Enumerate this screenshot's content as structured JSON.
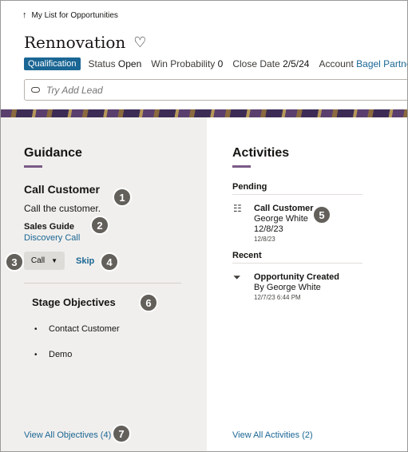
{
  "header": {
    "breadcrumb": "My List for Opportunities",
    "title": "Rennovation",
    "stage_badge": "Qualification",
    "status_label": "Status",
    "status_value": "Open",
    "win_label": "Win Probability",
    "win_value": "0",
    "close_label": "Close Date",
    "close_value": "2/5/24",
    "account_label": "Account",
    "account_value": "Bagel Partners Inc",
    "lead_placeholder": "Try Add Lead"
  },
  "guidance": {
    "title": "Guidance",
    "task_title": "Call Customer",
    "task_text": "Call the customer.",
    "sales_guide_label": "Sales Guide",
    "sales_guide_link": "Discovery Call",
    "call_button": "Call",
    "skip_link": "Skip",
    "objectives_title": "Stage Objectives",
    "objectives": [
      "Contact Customer",
      "Demo"
    ],
    "view_all": "View All Objectives (4)"
  },
  "activities": {
    "title": "Activities",
    "pending_label": "Pending",
    "pending": {
      "title": "Call Customer",
      "owner": "George White",
      "date": "12/8/23",
      "date_small": "12/8/23"
    },
    "recent_label": "Recent",
    "recent": {
      "title": "Opportunity Created",
      "owner": "By George White",
      "timestamp": "12/7/23 6:44 PM"
    },
    "view_all": "View All Activities (2)"
  },
  "callouts": [
    "1",
    "2",
    "3",
    "4",
    "5",
    "6",
    "7"
  ],
  "colors": {
    "accent": "#1a6694",
    "badge": "#1a6694",
    "underline": "#7a5a86",
    "callout": "#63605b",
    "panel": "#f1efed"
  },
  "icons": {
    "breadcrumb": "arrow-up-icon",
    "favorite": "heart-icon",
    "lead": "lead-icon",
    "pending": "checklist-icon",
    "recent": "funnel-icon"
  }
}
